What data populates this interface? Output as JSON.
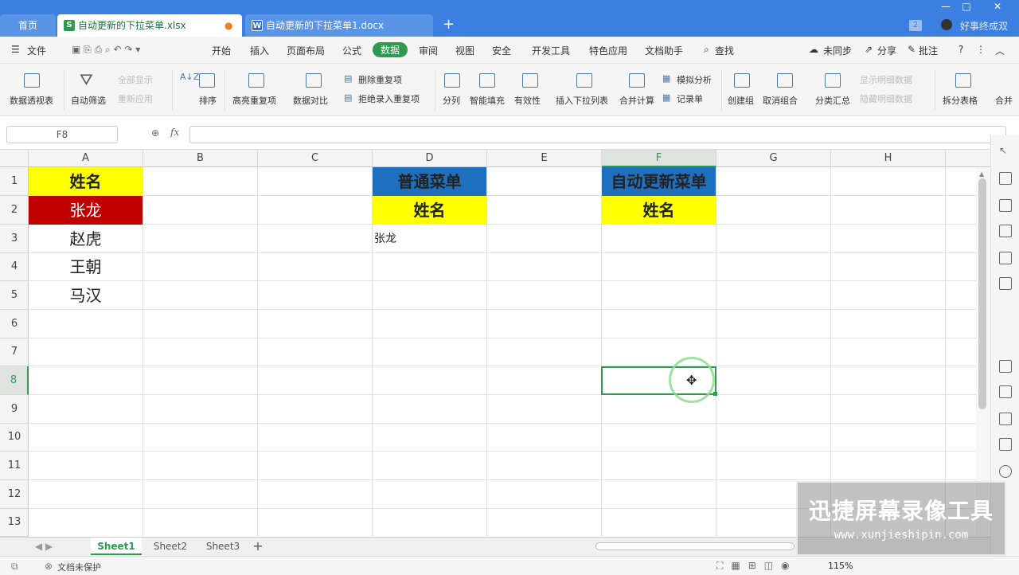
{
  "tabs": {
    "home": "首页",
    "xlsx": "自动更新的下拉菜单.xlsx",
    "docx": "自动更新的下拉菜单1.docx",
    "badge": "2",
    "user": "好事终成双"
  },
  "menu": {
    "file": "文件",
    "items": [
      "开始",
      "插入",
      "页面布局",
      "公式",
      "数据",
      "审阅",
      "视图",
      "安全",
      "开发工具",
      "特色应用",
      "文档助手"
    ],
    "search": "查找",
    "sync": "未同步",
    "share": "分享",
    "comment": "批注"
  },
  "ribbon": {
    "pivot": "数据透视表",
    "autofilter": "自动筛选",
    "showall": "全部显示",
    "reapply": "重新应用",
    "sort": "排序",
    "highlight_dup": "高亮重复项",
    "compare": "数据对比",
    "remove_dup": "删除重复项",
    "reject_dup": "拒绝录入重复项",
    "split": "分列",
    "fill": "智能填充",
    "validity": "有效性",
    "insert_dropdown": "插入下拉列表",
    "merge_calc": "合并计算",
    "simulate": "模拟分析",
    "record": "记录单",
    "create_group": "创建组",
    "ungroup": "取消组合",
    "subtotal": "分类汇总",
    "show_detail": "显示明细数据",
    "hide_detail": "隐藏明细数据",
    "split_table": "拆分表格",
    "merge_table": "合并"
  },
  "formula": {
    "namebox": "F8",
    "fx": "fx",
    "value": ""
  },
  "columns": [
    "A",
    "B",
    "C",
    "D",
    "E",
    "F",
    "G",
    "H"
  ],
  "rows": [
    "1",
    "2",
    "3",
    "4",
    "5",
    "6",
    "7",
    "8",
    "9",
    "10",
    "11",
    "12",
    "13"
  ],
  "cells": {
    "A1": "姓名",
    "A2": "张龙",
    "A3": "赵虎",
    "A4": "王朝",
    "A5": "马汉",
    "D1": "普通菜单",
    "D2": "姓名",
    "D3": "张龙",
    "F1": "自动更新菜单",
    "F2": "姓名"
  },
  "colors": {
    "yellow": "#ffff00",
    "red": "#c00000",
    "blue": "#1f6fbf",
    "accent": "#2e9a4f"
  },
  "sheets": [
    "Sheet1",
    "Sheet2",
    "Sheet3"
  ],
  "status": {
    "protect": "文档未保护",
    "zoom": "115%"
  },
  "watermark": {
    "title": "迅捷屏幕录像工具",
    "url": "www.xunjieshipin.com"
  }
}
